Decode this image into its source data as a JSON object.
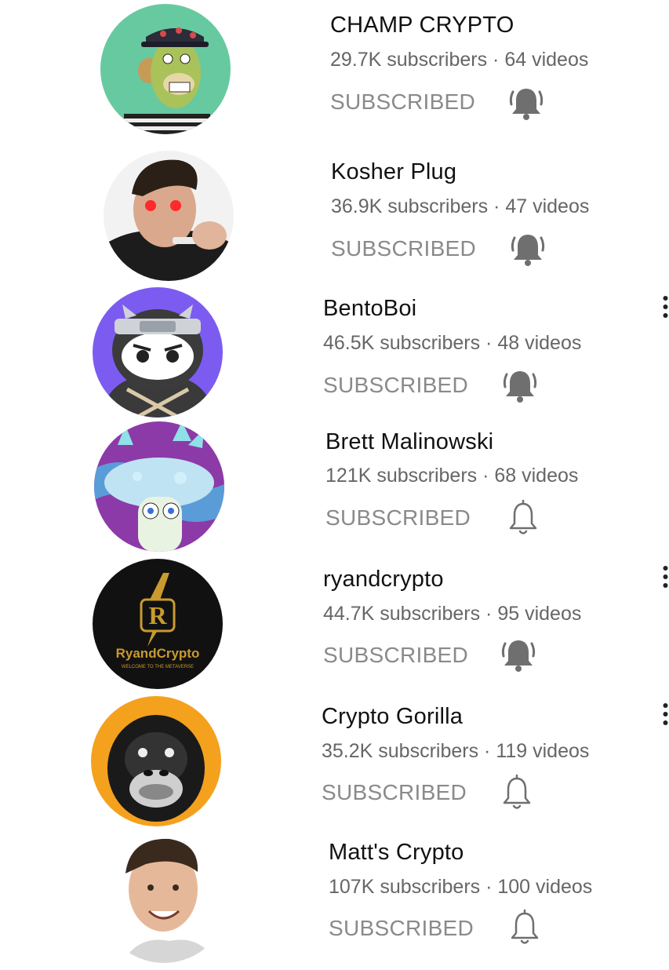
{
  "subscribed_label": "SUBSCRIBED",
  "channels": [
    {
      "name": "CHAMP CRYPTO",
      "subscribers": "29.7K subscribers",
      "videos": "64 videos",
      "bell": "all",
      "avatar": "ape-icon"
    },
    {
      "name": "Kosher Plug",
      "subscribers": "36.9K subscribers",
      "videos": "47 videos",
      "bell": "all",
      "avatar": "person-photo"
    },
    {
      "name": "BentoBoi",
      "subscribers": "46.5K subscribers",
      "videos": "48 videos",
      "bell": "all",
      "avatar": "ninja-icon"
    },
    {
      "name": "Brett Malinowski",
      "subscribers": "121K subscribers",
      "videos": "68 videos",
      "bell": "personalized",
      "avatar": "mushroom-icon"
    },
    {
      "name": "ryandcrypto",
      "subscribers": "44.7K subscribers",
      "videos": "95 videos",
      "bell": "all",
      "avatar": "ryandcrypto-logo",
      "avatar_text": {
        "title": "RyandCrypto",
        "tagline": "WELCOME TO THE METAVERSE"
      }
    },
    {
      "name": "Crypto Gorilla",
      "subscribers": "35.2K subscribers",
      "videos": "119 videos",
      "bell": "personalized",
      "avatar": "gorilla-icon"
    },
    {
      "name": "Matt's Crypto",
      "subscribers": "107K subscribers",
      "videos": "100 videos",
      "bell": "personalized",
      "avatar": "person-photo"
    }
  ],
  "colors": {
    "name_text": "#111111",
    "meta_text": "#666666",
    "subscribed_text": "#8a8a8a",
    "bell_fill": "#6f6f6f"
  }
}
